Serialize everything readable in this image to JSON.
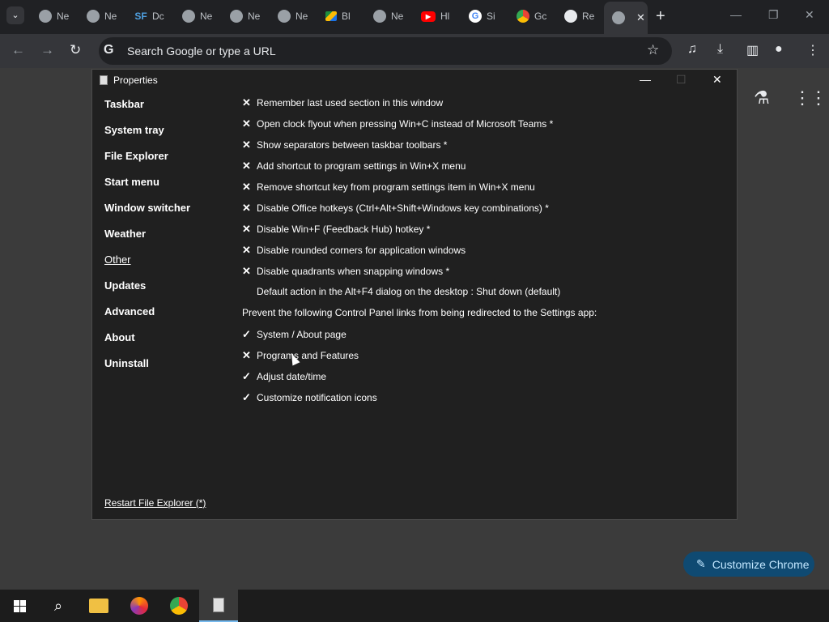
{
  "browser": {
    "tabs": [
      {
        "label": "Ne",
        "favicon": "chrome-icon"
      },
      {
        "label": "Ne",
        "favicon": "chrome-icon"
      },
      {
        "label": "Dc",
        "favicon": "sf-icon"
      },
      {
        "label": "Ne",
        "favicon": "chrome-icon"
      },
      {
        "label": "Ne",
        "favicon": "chrome-icon"
      },
      {
        "label": "Ne",
        "favicon": "chrome-icon"
      },
      {
        "label": "Bl",
        "favicon": "drive-icon"
      },
      {
        "label": "Ne",
        "favicon": "chrome-icon"
      },
      {
        "label": "Hl",
        "favicon": "youtube-icon"
      },
      {
        "label": "Si",
        "favicon": "google-icon"
      },
      {
        "label": "Gc",
        "favicon": "chrome-logo-icon"
      },
      {
        "label": "Re",
        "favicon": "github-icon"
      },
      {
        "label": "",
        "favicon": "chrome-icon",
        "active": true
      }
    ],
    "omnibox_placeholder": "Search Google or type a URL",
    "customize_label": "Customize Chrome",
    "sf_glyph": "SF",
    "yt_glyph": "▶",
    "g_glyph": "G"
  },
  "window": {
    "title": "Properties",
    "nav": [
      {
        "label": "Taskbar"
      },
      {
        "label": "System tray"
      },
      {
        "label": "File Explorer"
      },
      {
        "label": "Start menu"
      },
      {
        "label": "Window switcher"
      },
      {
        "label": "Weather"
      },
      {
        "label": "Other",
        "selected": true
      },
      {
        "label": "Updates"
      },
      {
        "label": "Advanced"
      },
      {
        "label": "About"
      },
      {
        "label": "Uninstall"
      }
    ],
    "options": [
      {
        "mark": "✕",
        "label": "Remember last used section in this window"
      },
      {
        "mark": "✕",
        "label": "Open clock flyout when pressing Win+C instead of Microsoft Teams *"
      },
      {
        "mark": "✕",
        "label": "Show separators between taskbar toolbars *"
      },
      {
        "mark": "✕",
        "label": "Add shortcut to program settings in Win+X menu"
      },
      {
        "mark": "✕",
        "label": "Remove shortcut key from program settings item in Win+X menu"
      },
      {
        "mark": "✕",
        "label": "Disable Office hotkeys (Ctrl+Alt+Shift+Windows key combinations) *"
      },
      {
        "mark": "✕",
        "label": "Disable Win+F (Feedback Hub) hotkey *"
      },
      {
        "mark": "✕",
        "label": "Disable rounded corners for application windows"
      },
      {
        "mark": "✕",
        "label": "Disable quadrants when snapping windows *"
      },
      {
        "mark": "",
        "label": "Default action in the Alt+F4 dialog on the desktop : Shut down (default)"
      },
      {
        "mark": null,
        "label": "Prevent the following Control Panel links from being redirected to the Settings app:"
      },
      {
        "mark": "✓",
        "label": "System / About page"
      },
      {
        "mark": "✕",
        "label": "Programs and Features"
      },
      {
        "mark": "✓",
        "label": "Adjust date/time"
      },
      {
        "mark": "✓",
        "label": "Customize notification icons"
      }
    ],
    "restart_label": "Restart File Explorer (*)"
  },
  "colors": {
    "accent": "#76b9ed",
    "window_bg": "#202020",
    "chrome_dark": "#202124"
  }
}
